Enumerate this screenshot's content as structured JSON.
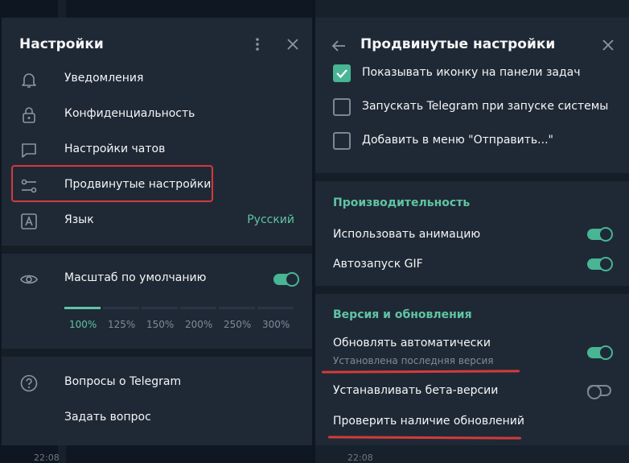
{
  "background": {
    "times": [
      "22:08",
      "22:08"
    ]
  },
  "left": {
    "title": "Настройки",
    "menu": [
      {
        "label": "Уведомления",
        "icon": "bell-icon"
      },
      {
        "label": "Конфиденциальность",
        "icon": "lock-icon"
      },
      {
        "label": "Настройки чатов",
        "icon": "chat-bubble-icon"
      },
      {
        "label": "Продвинутые настройки",
        "icon": "sliders-icon"
      },
      {
        "label": "Язык",
        "value": "Русский",
        "icon": "language-icon"
      }
    ],
    "scale": {
      "label": "Масштаб по умолчанию",
      "default_enabled": true,
      "options": [
        "100%",
        "125%",
        "150%",
        "200%",
        "250%",
        "300%"
      ],
      "selected": "100%"
    },
    "help": [
      {
        "label": "Вопросы о Telegram",
        "icon": "question-icon"
      },
      {
        "label": "Задать вопрос"
      }
    ]
  },
  "right": {
    "title": "Продвинутые настройки",
    "checkboxes": [
      {
        "label": "Показывать иконку на панели задач",
        "checked": true
      },
      {
        "label": "Запускать Telegram при запуске системы",
        "checked": false
      },
      {
        "label": "Добавить в меню \"Отправить...\"",
        "checked": false
      }
    ],
    "performance": {
      "title": "Производительность",
      "rows": [
        {
          "label": "Использовать анимацию",
          "on": true
        },
        {
          "label": "Автозапуск GIF",
          "on": true
        }
      ]
    },
    "updates": {
      "title": "Версия и обновления",
      "auto_update": {
        "label": "Обновлять автоматически",
        "sub": "Установлена последняя версия",
        "on": true
      },
      "beta": {
        "label": "Устанавливать бета-версии",
        "on": false
      },
      "check": {
        "label": "Проверить наличие обновлений"
      }
    }
  },
  "colors": {
    "accent": "#5fc4a3",
    "annotation": "#d43a3a",
    "panel": "#1f2936"
  }
}
